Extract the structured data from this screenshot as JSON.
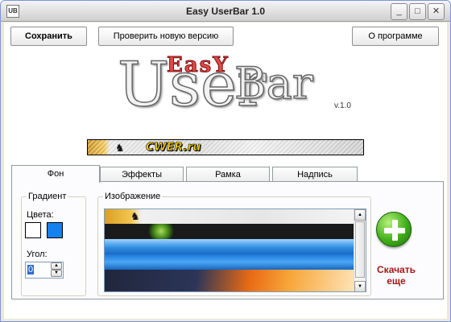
{
  "window": {
    "title": "Easy UserBar 1.0",
    "app_icon_label": "UB",
    "minimize_glyph": "_",
    "maximize_glyph": "□",
    "close_glyph": "✕"
  },
  "toolbar": {
    "save_label": "Сохранить",
    "check_update_label": "Проверить новую версию",
    "about_label": "О программе"
  },
  "logo": {
    "easy": "EasY",
    "user": "User",
    "bar": "Bar",
    "version": "v.1.0"
  },
  "preview": {
    "text": "CWER.ru",
    "figure_icon": "figure-icon"
  },
  "tabs": [
    {
      "label": "Фон",
      "active": true
    },
    {
      "label": "Эффекты",
      "active": false
    },
    {
      "label": "Рамка",
      "active": false
    },
    {
      "label": "Надпись",
      "active": false
    }
  ],
  "gradient": {
    "group_title": "Градиент",
    "colors_label": "Цвета:",
    "color1": "#ffffff",
    "color2": "#1580f0",
    "angle_label": "Угол:",
    "angle_value": "0"
  },
  "image": {
    "group_title": "Изображение"
  },
  "download": {
    "label_line1": "Скачать",
    "label_line2": "еще",
    "icon": "plus-icon"
  },
  "colors": {
    "accent_red": "#a61616",
    "download_green": "#3fae1a",
    "selection_blue": "#316ac5"
  }
}
